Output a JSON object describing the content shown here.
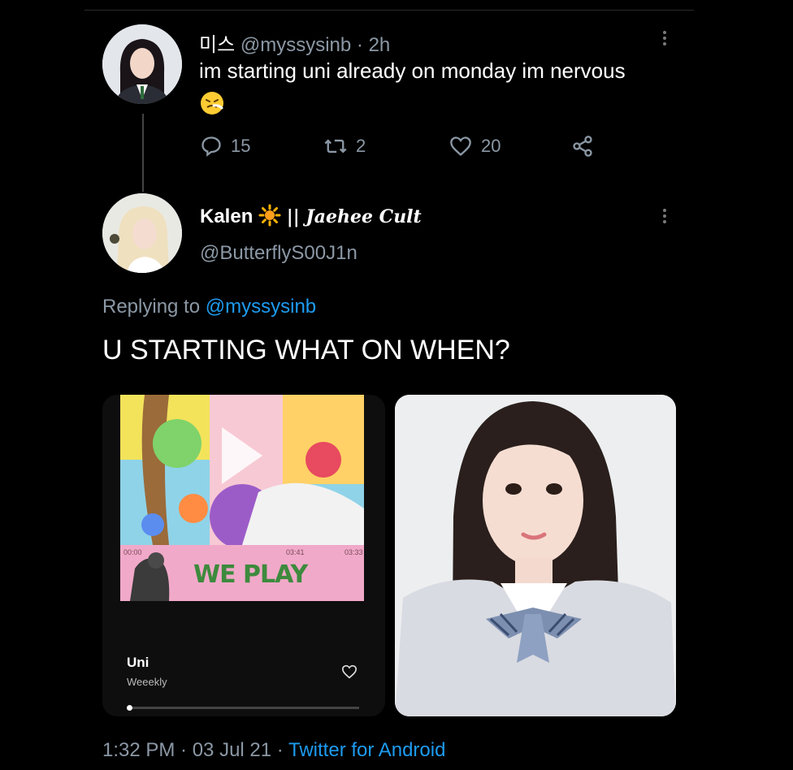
{
  "original_tweet": {
    "display_name": "미스",
    "handle": "@myssysinb",
    "time": "· 2h",
    "text": "im starting uni already on monday im nervous",
    "reply_count": "15",
    "retweet_count": "2",
    "like_count": "20"
  },
  "reply_tweet": {
    "display_name": "Kalen",
    "name_suffix": "|| Jaehee Cult",
    "handle": "@ButterflyS00J1n",
    "replying_prefix": "Replying to",
    "replying_to": "@myssysinb",
    "text": "U STARTING WHAT ON WHEN?",
    "timestamp": "1:32 PM · 03 Jul 21 ·",
    "source": "Twitter for Android"
  },
  "music_card": {
    "song_title": "Uni",
    "artist": "Weeekly",
    "album_text": "WE PLAY",
    "time_left": "00:00",
    "time_mid": "03:41",
    "time_right": "03:33"
  },
  "colors": {
    "background": "#000000",
    "secondary_text": "#8b98a5",
    "link": "#1d9bf0"
  }
}
